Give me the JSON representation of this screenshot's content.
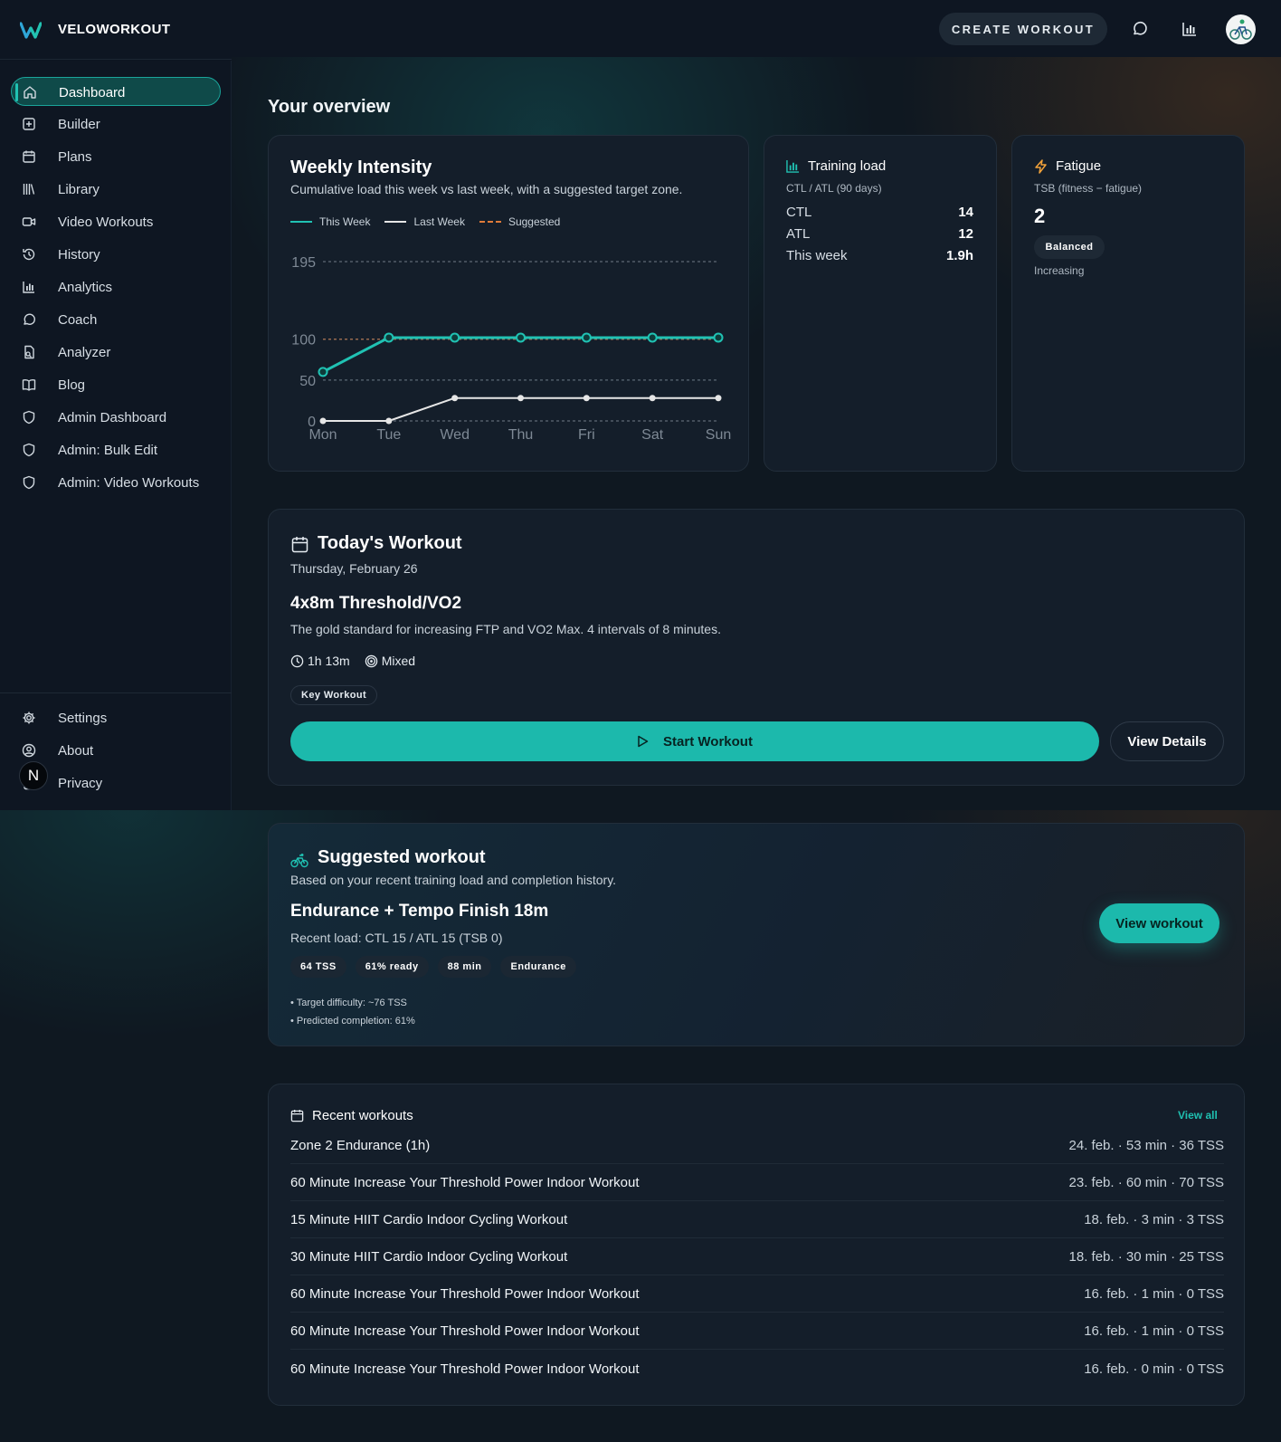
{
  "app": {
    "brand": "VELOWORKOUT",
    "brand_color": "#1fc0b1"
  },
  "topbar": {
    "create_label": "CREATE WORKOUT",
    "icons": [
      "chat-icon",
      "bar-chart-icon"
    ]
  },
  "sidebar": {
    "items": [
      {
        "label": "Dashboard",
        "icon": "home-icon",
        "active": true
      },
      {
        "label": "Builder",
        "icon": "plus-square-icon"
      },
      {
        "label": "Plans",
        "icon": "calendar-icon"
      },
      {
        "label": "Library",
        "icon": "library-icon"
      },
      {
        "label": "Video Workouts",
        "icon": "video-icon"
      },
      {
        "label": "History",
        "icon": "history-icon"
      },
      {
        "label": "Analytics",
        "icon": "bar-chart-icon"
      },
      {
        "label": "Coach",
        "icon": "chat-icon"
      },
      {
        "label": "Analyzer",
        "icon": "file-search-icon"
      },
      {
        "label": "Blog",
        "icon": "book-icon"
      },
      {
        "label": "Admin Dashboard",
        "icon": "shield-icon"
      },
      {
        "label": "Admin: Bulk Edit",
        "icon": "shield-icon"
      },
      {
        "label": "Admin: Video Workouts",
        "icon": "shield-icon"
      }
    ],
    "bottom_items": [
      {
        "label": "Settings",
        "icon": "gear-icon"
      },
      {
        "label": "About",
        "icon": "user-circle-icon"
      },
      {
        "label": "Privacy",
        "icon": "lock-icon"
      }
    ],
    "badge_letter": "N"
  },
  "overview": {
    "title": "Your overview"
  },
  "weekly": {
    "title": "Weekly Intensity",
    "subtitle": "Cumulative load this week vs last week, with a suggested target zone.",
    "legend": {
      "this_week": "This Week",
      "last_week": "Last Week",
      "suggested": "Suggested"
    }
  },
  "chart_data": {
    "type": "line",
    "title": "Weekly Intensity",
    "categories": [
      "Mon",
      "Tue",
      "Wed",
      "Thu",
      "Fri",
      "Sat",
      "Sun"
    ],
    "series": [
      {
        "name": "This Week",
        "color": "#20c2b3",
        "values": [
          60,
          102,
          102,
          102,
          102,
          102,
          102
        ]
      },
      {
        "name": "Last Week",
        "color": "#e6e6e6",
        "values": [
          0,
          0,
          28,
          28,
          28,
          28,
          28
        ]
      }
    ],
    "reference_lines": [
      {
        "name": "Suggested",
        "color": "#e07b39",
        "values": [
          100
        ]
      }
    ],
    "y_ticks": [
      0,
      50,
      100,
      195
    ],
    "ylim": [
      0,
      195
    ],
    "grid": true,
    "legend_position": "top-left"
  },
  "training_load": {
    "title": "Training load",
    "subtitle": "CTL / ATL (90 days)",
    "rows": [
      {
        "label": "CTL",
        "value": "14"
      },
      {
        "label": "ATL",
        "value": "12"
      },
      {
        "label": "This week",
        "value": "1.9h"
      }
    ]
  },
  "fatigue": {
    "title": "Fatigue",
    "subtitle": "TSB (fitness − fatigue)",
    "value": "2",
    "badge": "Balanced",
    "trend": "Increasing",
    "icon_color": "#f2a23a"
  },
  "today": {
    "title": "Today's Workout",
    "date": "Thursday, February 26",
    "name": "4x8m Threshold/VO2",
    "description": "The gold standard for increasing FTP and VO2 Max. 4 intervals of 8 minutes.",
    "duration": "1h 13m",
    "type": "Mixed",
    "tag": "Key Workout",
    "start_label": "Start Workout",
    "details_label": "View Details"
  },
  "suggested": {
    "title": "Suggested workout",
    "subtitle": "Based on your recent training load and completion history.",
    "name": "Endurance + Tempo Finish 18m",
    "load": "Recent load: CTL 15 / ATL 15 (TSB 0)",
    "pills": [
      "64 TSS",
      "61% ready",
      "88 min",
      "Endurance"
    ],
    "notes": [
      "• Target difficulty: ~76 TSS",
      "• Predicted completion: 61%"
    ],
    "button": "View workout"
  },
  "recent": {
    "title": "Recent workouts",
    "view_all": "View all",
    "rows": [
      {
        "name": "Zone 2 Endurance (1h)",
        "meta": "24. feb. · 53 min · 36 TSS"
      },
      {
        "name": "60 Minute Increase Your Threshold Power Indoor Workout",
        "meta": "23. feb. · 60 min · 70 TSS"
      },
      {
        "name": "15 Minute HIIT Cardio Indoor Cycling Workout",
        "meta": "18. feb. · 3 min · 3 TSS"
      },
      {
        "name": "30 Minute HIIT Cardio Indoor Cycling Workout",
        "meta": "18. feb. · 30 min · 25 TSS"
      },
      {
        "name": "60 Minute Increase Your Threshold Power Indoor Workout",
        "meta": "16. feb. · 1 min · 0 TSS"
      },
      {
        "name": "60 Minute Increase Your Threshold Power Indoor Workout",
        "meta": "16. feb. · 1 min · 0 TSS"
      },
      {
        "name": "60 Minute Increase Your Threshold Power Indoor Workout",
        "meta": "16. feb. · 0 min · 0 TSS"
      }
    ]
  }
}
